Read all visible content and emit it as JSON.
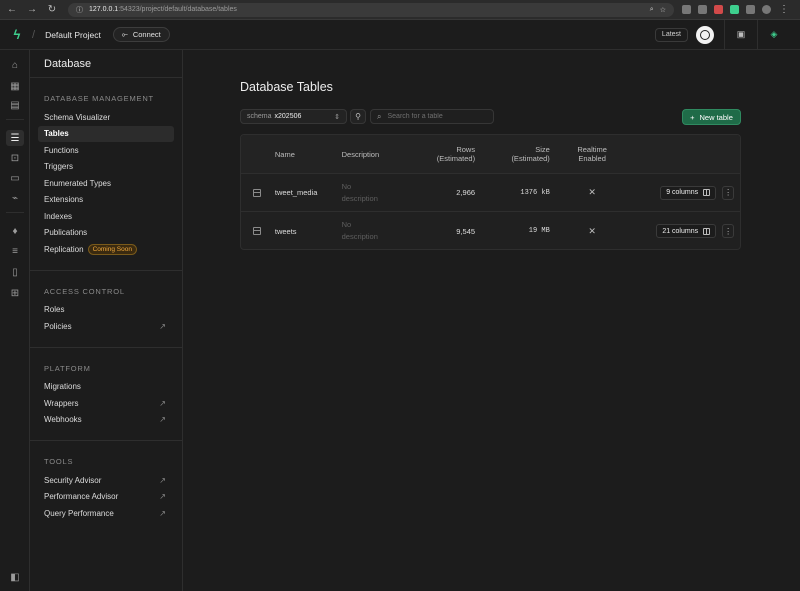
{
  "browser": {
    "url_host": "127.0.0.1",
    "url_path": ":54323/project/default/database/tables"
  },
  "topbar": {
    "project_name": "Default Project",
    "connect_label": "Connect",
    "latest_label": "Latest"
  },
  "sidebar": {
    "title": "Database",
    "sections": [
      {
        "title": "DATABASE MANAGEMENT",
        "items": [
          {
            "label": "Schema Visualizer"
          },
          {
            "label": "Tables",
            "active": true
          },
          {
            "label": "Functions"
          },
          {
            "label": "Triggers"
          },
          {
            "label": "Enumerated Types"
          },
          {
            "label": "Extensions"
          },
          {
            "label": "Indexes"
          },
          {
            "label": "Publications"
          },
          {
            "label": "Replication",
            "badge": "Coming Soon"
          }
        ]
      },
      {
        "title": "ACCESS CONTROL",
        "items": [
          {
            "label": "Roles"
          },
          {
            "label": "Policies",
            "external": true
          }
        ]
      },
      {
        "title": "PLATFORM",
        "items": [
          {
            "label": "Migrations"
          },
          {
            "label": "Wrappers",
            "external": true
          },
          {
            "label": "Webhooks",
            "external": true
          }
        ]
      },
      {
        "title": "TOOLS",
        "items": [
          {
            "label": "Security Advisor",
            "external": true
          },
          {
            "label": "Performance Advisor",
            "external": true
          },
          {
            "label": "Query Performance",
            "external": true
          }
        ]
      }
    ]
  },
  "main": {
    "title": "Database Tables",
    "schema_prefix": "schema",
    "schema_value": "x202506",
    "search_placeholder": "Search for a table",
    "new_table_label": "New table",
    "columns": {
      "name": "Name",
      "description": "Description",
      "rows_line1": "Rows",
      "rows_line2": "(Estimated)",
      "size_line1": "Size",
      "size_line2": "(Estimated)",
      "realtime_line1": "Realtime",
      "realtime_line2": "Enabled"
    },
    "rows": [
      {
        "name": "tweet_media",
        "desc1": "No",
        "desc2": "description",
        "rows": "2,966",
        "size": "1376 kB",
        "columns": "9 columns"
      },
      {
        "name": "tweets",
        "desc1": "No",
        "desc2": "description",
        "rows": "9,545",
        "size": "19 MB",
        "columns": "21 columns"
      }
    ]
  },
  "colors": {
    "accent": "#3ecf8e",
    "primary_button": "#1f6b48",
    "badge": "#f0a83c"
  }
}
